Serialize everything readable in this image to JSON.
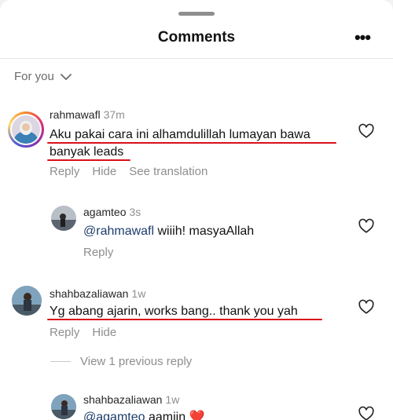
{
  "header": {
    "title": "Comments",
    "more_icon": "more-horizontal-icon"
  },
  "filter": {
    "label": "For you",
    "icon": "chevron-down-icon"
  },
  "comments": [
    {
      "username": "rahmawafl",
      "time": "37m",
      "line1": "Aku pakai cara ini alhamdulillah lumayan bawa",
      "line2": "banyak leads",
      "actions": [
        "Reply",
        "Hide",
        "See translation"
      ]
    },
    {
      "username": "agamteo",
      "time": "3s",
      "mention": "@rahmawafl",
      "text": " wiiih! masyaAllah",
      "actions": [
        "Reply"
      ]
    },
    {
      "username": "shahbazaliawan",
      "time": "1w",
      "text": "Yg abang ajarin, works bang.. thank you yah",
      "actions": [
        "Reply",
        "Hide"
      ]
    },
    {
      "username": "shahbazaliawan",
      "time": "1w",
      "mention": "@agamteo",
      "text": " aamiin",
      "emoji": "❤️"
    }
  ],
  "view_previous": "View 1 previous reply",
  "colors": {
    "underline": "#d8101c",
    "mention": "#1d3d6b",
    "muted": "#8e8e8e"
  }
}
